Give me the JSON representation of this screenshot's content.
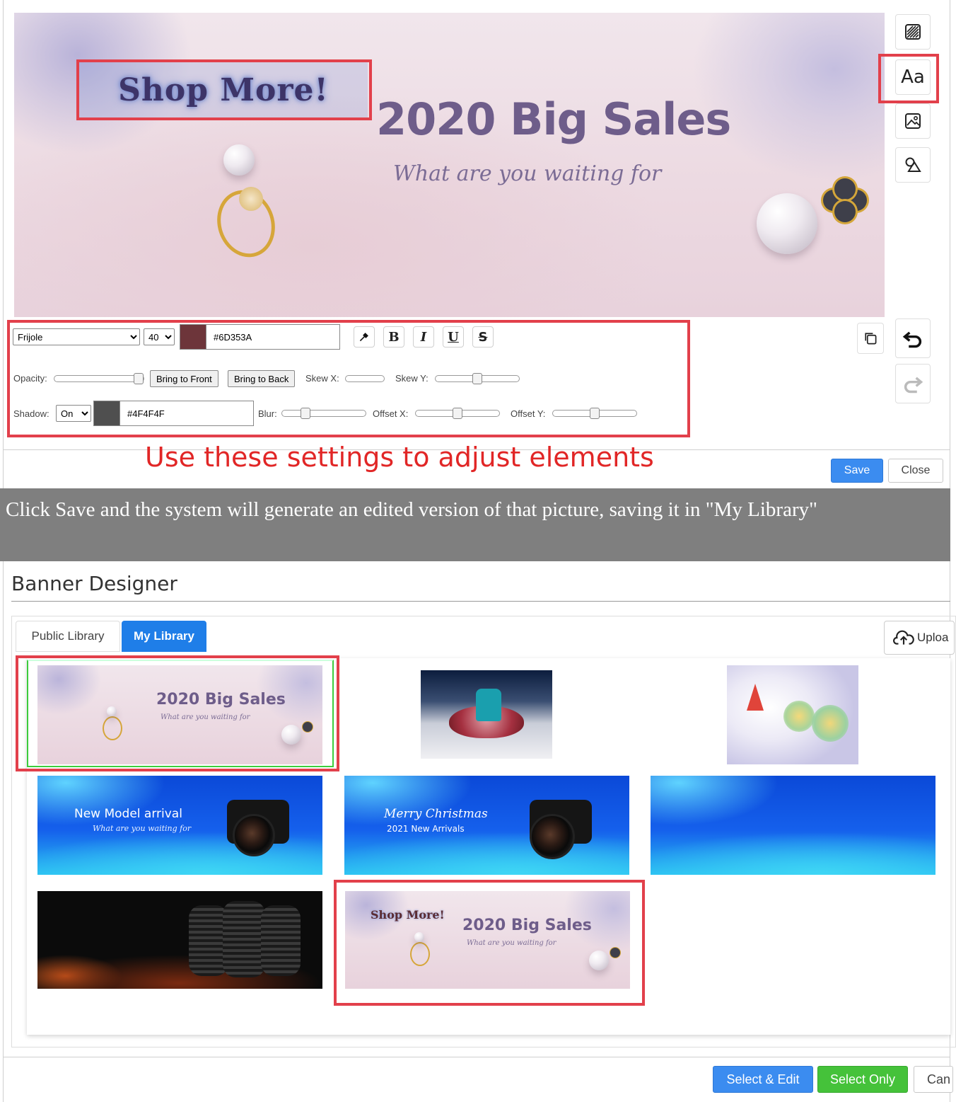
{
  "editor": {
    "canvas": {
      "shop_more": "Shop More!",
      "title": "2020 Big Sales",
      "subtitle": "What are you waiting for"
    },
    "toolbar": {
      "background_icon": "background-icon",
      "text_icon_label": "Aa",
      "image_icon": "image-icon",
      "shapes_icon": "shapes-icon",
      "duplicate_icon": "duplicate-icon",
      "undo_icon": "undo-icon",
      "redo_icon": "redo-icon"
    },
    "settings": {
      "font": "Frijole",
      "size": "40",
      "color_hex": "#6D353A",
      "color_value": "#6D353A",
      "bold": "B",
      "italic": "I",
      "underline": "U",
      "strike": "S",
      "opacity_label": "Opacity:",
      "opacity_value": 1.0,
      "bring_front": "Bring to Front",
      "bring_back": "Bring to Back",
      "skew_x_label": "Skew X:",
      "skew_x_value": 0.0,
      "skew_y_label": "Skew Y:",
      "skew_y_value": 0.5,
      "shadow_label": "Shadow:",
      "shadow_value": "On",
      "shadow_hex": "#4F4F4F",
      "shadow_color": "#4F4F4F",
      "blur_label": "Blur:",
      "blur_value": 0.25,
      "offset_x_label": "Offset X:",
      "offset_x_value": 0.5,
      "offset_y_label": "Offset Y:",
      "offset_y_value": 0.5
    },
    "hint": "Use these settings to adjust elements",
    "save_label": "Save",
    "close_label": "Close"
  },
  "caption": "Click Save and the system will generate an edited version of that picture, saving it in \"My Library\"",
  "designer": {
    "title": "Banner Designer",
    "tabs": [
      {
        "label": "Public Library",
        "active": false
      },
      {
        "label": "My Library",
        "active": true
      }
    ],
    "upload_label": "Uploa",
    "thumbnails": {
      "jewel_title": "2020 Big Sales",
      "jewel_subtitle": "What are you waiting for",
      "camera1_title": "New Model arrival",
      "camera1_subtitle": "What are you waiting for",
      "camera2_title": "Merry Christmas",
      "camera2_subtitle": "2021 New Arrivals",
      "edited_shop_more": "Shop More!",
      "edited_title": "2020 Big Sales",
      "edited_subtitle": "What are you waiting for"
    },
    "select_edit_label": "Select & Edit",
    "select_only_label": "Select Only",
    "cancel_label": "Can"
  },
  "colors": {
    "highlight": "#e2404b",
    "primary": "#3b8cf0",
    "success": "#45c23a",
    "active_tab": "#1f7ee8"
  }
}
